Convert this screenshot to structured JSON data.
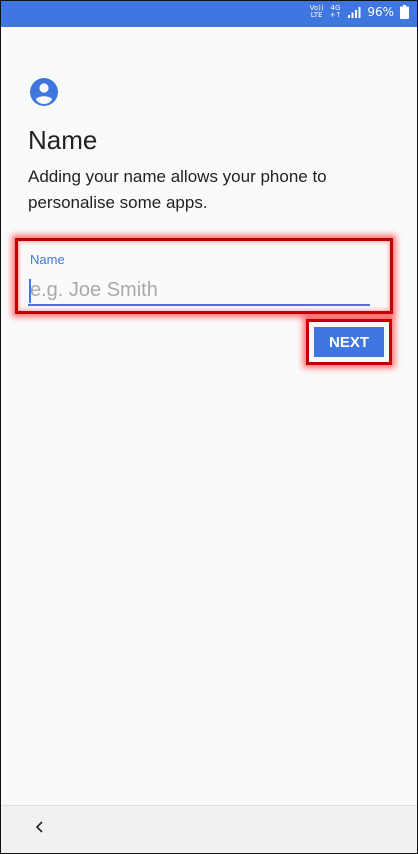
{
  "status_bar": {
    "volte_top": "Vo))",
    "volte_bottom": "LTE",
    "network_top": "4G",
    "network_bottom": "+↑",
    "battery_percent": "96%",
    "background_color": "#3f76df"
  },
  "header": {
    "icon": "account-circle-icon",
    "title": "Name",
    "subtitle": "Adding your name allows your phone to personalise some apps."
  },
  "name_field": {
    "label": "Name",
    "value": "",
    "placeholder": "e.g. Joe Smith",
    "accent_color": "#3f76df"
  },
  "actions": {
    "next_label": "NEXT"
  },
  "navigation": {
    "back_icon": "chevron-left-icon"
  },
  "highlight_color": "#c30000"
}
